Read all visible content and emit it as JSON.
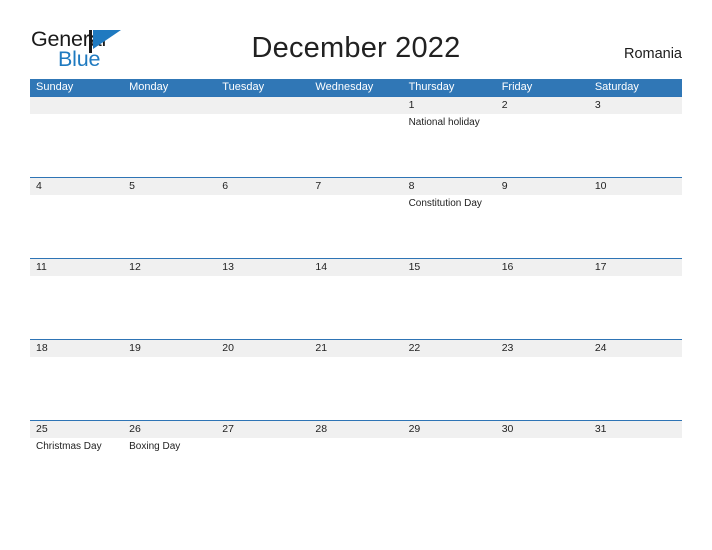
{
  "logo": {
    "text_top": "General",
    "text_bottom": "Blue",
    "triangle_color": "#1f7ac0",
    "text_top_color": "#1a1a1a"
  },
  "header": {
    "title": "December 2022",
    "country": "Romania",
    "header_bg_color": "#3077b6",
    "row_line_color": "#2e74b5",
    "band_color": "#f0f0f0"
  },
  "weekdays": [
    "Sunday",
    "Monday",
    "Tuesday",
    "Wednesday",
    "Thursday",
    "Friday",
    "Saturday"
  ],
  "weeks": [
    [
      {
        "day": "",
        "event": ""
      },
      {
        "day": "",
        "event": ""
      },
      {
        "day": "",
        "event": ""
      },
      {
        "day": "",
        "event": ""
      },
      {
        "day": "1",
        "event": "National holiday"
      },
      {
        "day": "2",
        "event": ""
      },
      {
        "day": "3",
        "event": ""
      }
    ],
    [
      {
        "day": "4",
        "event": ""
      },
      {
        "day": "5",
        "event": ""
      },
      {
        "day": "6",
        "event": ""
      },
      {
        "day": "7",
        "event": ""
      },
      {
        "day": "8",
        "event": "Constitution Day"
      },
      {
        "day": "9",
        "event": ""
      },
      {
        "day": "10",
        "event": ""
      }
    ],
    [
      {
        "day": "11",
        "event": ""
      },
      {
        "day": "12",
        "event": ""
      },
      {
        "day": "13",
        "event": ""
      },
      {
        "day": "14",
        "event": ""
      },
      {
        "day": "15",
        "event": ""
      },
      {
        "day": "16",
        "event": ""
      },
      {
        "day": "17",
        "event": ""
      }
    ],
    [
      {
        "day": "18",
        "event": ""
      },
      {
        "day": "19",
        "event": ""
      },
      {
        "day": "20",
        "event": ""
      },
      {
        "day": "21",
        "event": ""
      },
      {
        "day": "22",
        "event": ""
      },
      {
        "day": "23",
        "event": ""
      },
      {
        "day": "24",
        "event": ""
      }
    ],
    [
      {
        "day": "25",
        "event": "Christmas Day"
      },
      {
        "day": "26",
        "event": "Boxing Day"
      },
      {
        "day": "27",
        "event": ""
      },
      {
        "day": "28",
        "event": ""
      },
      {
        "day": "29",
        "event": ""
      },
      {
        "day": "30",
        "event": ""
      },
      {
        "day": "31",
        "event": ""
      }
    ]
  ]
}
